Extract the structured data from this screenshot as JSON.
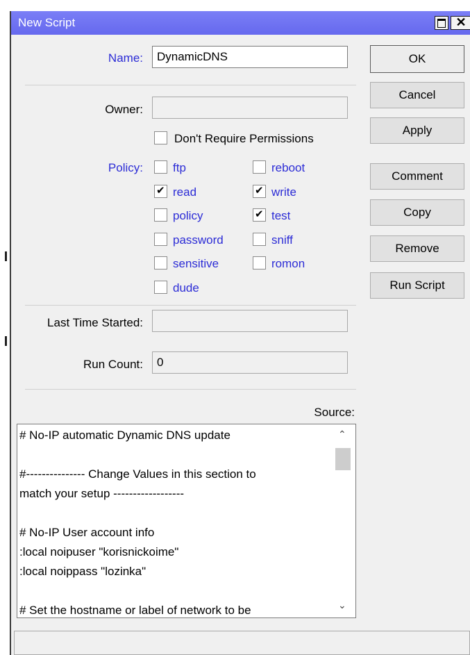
{
  "window": {
    "title": "New Script",
    "close_glyph": "✕"
  },
  "form": {
    "name_label": "Name:",
    "name_value": "DynamicDNS",
    "owner_label": "Owner:",
    "owner_value": "",
    "dont_require_label": "Don't Require Permissions",
    "policy_label": "Policy:",
    "last_started_label": "Last Time Started:",
    "last_started_value": "",
    "run_count_label": "Run Count:",
    "run_count_value": "0",
    "source_label": "Source:"
  },
  "policies": [
    {
      "label": "ftp",
      "checked": false
    },
    {
      "label": "reboot",
      "checked": false
    },
    {
      "label": "read",
      "checked": true
    },
    {
      "label": "write",
      "checked": true
    },
    {
      "label": "policy",
      "checked": false
    },
    {
      "label": "test",
      "checked": true
    },
    {
      "label": "password",
      "checked": false
    },
    {
      "label": "sniff",
      "checked": false
    },
    {
      "label": "sensitive",
      "checked": false
    },
    {
      "label": "romon",
      "checked": false
    },
    {
      "label": "dude",
      "checked": false
    }
  ],
  "buttons": {
    "ok": "OK",
    "cancel": "Cancel",
    "apply": "Apply",
    "comment": "Comment",
    "copy": "Copy",
    "remove": "Remove",
    "run_script": "Run Script"
  },
  "source_lines": [
    "# No-IP automatic Dynamic DNS update",
    "",
    "#--------------- Change Values in this section to",
    "match your setup ------------------",
    "",
    "# No-IP User account info",
    ":local noipuser \"korisnickoime\"",
    ":local noippass \"lozinka\"",
    "",
    "# Set the hostname or label of network to be"
  ],
  "scrollbar": {
    "up_glyph": "⌃",
    "down_glyph": "⌄"
  }
}
